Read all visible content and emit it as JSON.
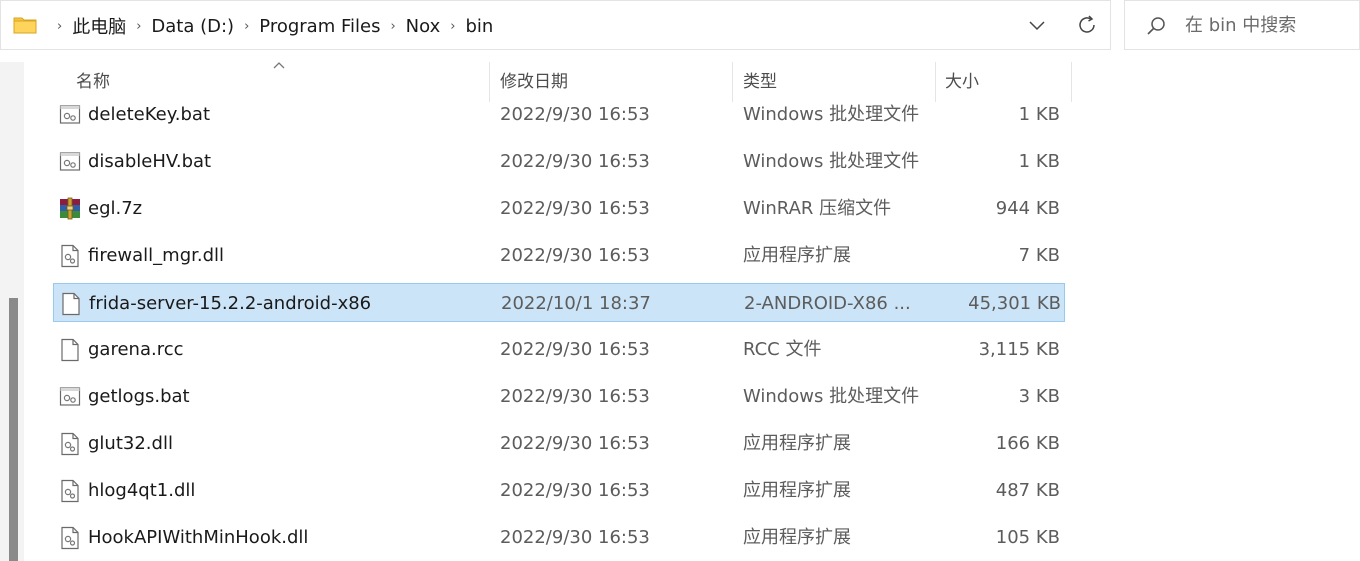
{
  "breadcrumb": {
    "items": [
      "此电脑",
      "Data (D:)",
      "Program Files",
      "Nox",
      "bin"
    ],
    "separator": "›"
  },
  "search": {
    "placeholder": "在 bin 中搜索"
  },
  "columns": {
    "name": "名称",
    "date": "修改日期",
    "type": "类型",
    "size": "大小"
  },
  "files": [
    {
      "name": "deleteKey.bat",
      "date": "2022/9/30 16:53",
      "type": "Windows 批处理文件",
      "size": "1 KB",
      "icon": "batch-file-icon",
      "selected": false
    },
    {
      "name": "disableHV.bat",
      "date": "2022/9/30 16:53",
      "type": "Windows 批处理文件",
      "size": "1 KB",
      "icon": "batch-file-icon",
      "selected": false
    },
    {
      "name": "egl.7z",
      "date": "2022/9/30 16:53",
      "type": "WinRAR 压缩文件",
      "size": "944 KB",
      "icon": "winrar-archive-icon",
      "selected": false
    },
    {
      "name": "firewall_mgr.dll",
      "date": "2022/9/30 16:53",
      "type": "应用程序扩展",
      "size": "7 KB",
      "icon": "dll-file-icon",
      "selected": false
    },
    {
      "name": "frida-server-15.2.2-android-x86",
      "date": "2022/10/1 18:37",
      "type": "2-ANDROID-X86 ...",
      "size": "45,301 KB",
      "icon": "generic-file-icon",
      "selected": true
    },
    {
      "name": "garena.rcc",
      "date": "2022/9/30 16:53",
      "type": "RCC 文件",
      "size": "3,115 KB",
      "icon": "generic-file-icon",
      "selected": false
    },
    {
      "name": "getlogs.bat",
      "date": "2022/9/30 16:53",
      "type": "Windows 批处理文件",
      "size": "3 KB",
      "icon": "batch-file-icon",
      "selected": false
    },
    {
      "name": "glut32.dll",
      "date": "2022/9/30 16:53",
      "type": "应用程序扩展",
      "size": "166 KB",
      "icon": "dll-file-icon",
      "selected": false
    },
    {
      "name": "hlog4qt1.dll",
      "date": "2022/9/30 16:53",
      "type": "应用程序扩展",
      "size": "487 KB",
      "icon": "dll-file-icon",
      "selected": false
    },
    {
      "name": "HookAPIWithMinHook.dll",
      "date": "2022/9/30 16:53",
      "type": "应用程序扩展",
      "size": "105 KB",
      "icon": "dll-file-icon",
      "selected": false
    }
  ],
  "colors": {
    "selection": "#cce4f7",
    "selection_border": "#99c9ef",
    "folder": "#f4c542"
  }
}
